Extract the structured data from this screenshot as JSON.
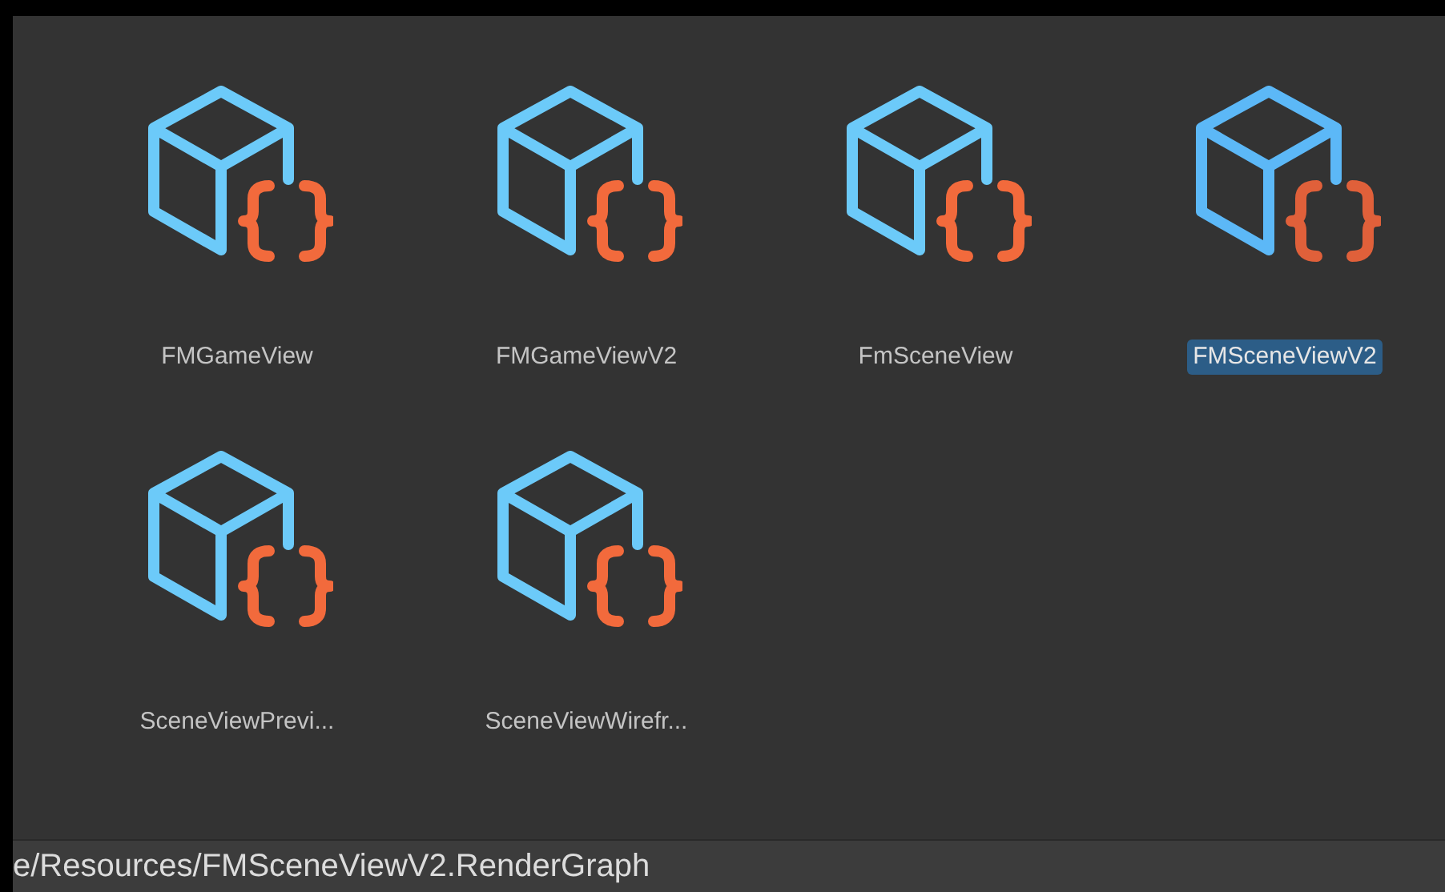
{
  "assets": [
    {
      "name": "FMGameView",
      "selected": false
    },
    {
      "name": "FMGameViewV2",
      "selected": false
    },
    {
      "name": "FmSceneView",
      "selected": false
    },
    {
      "name": "FMSceneViewV2",
      "selected": true
    },
    {
      "name": "SceneViewPrevi...",
      "selected": false
    },
    {
      "name": "SceneViewWirefr...",
      "selected": false
    }
  ],
  "status_bar": {
    "path": "e/Resources/FMSceneViewV2.RenderGraph"
  }
}
